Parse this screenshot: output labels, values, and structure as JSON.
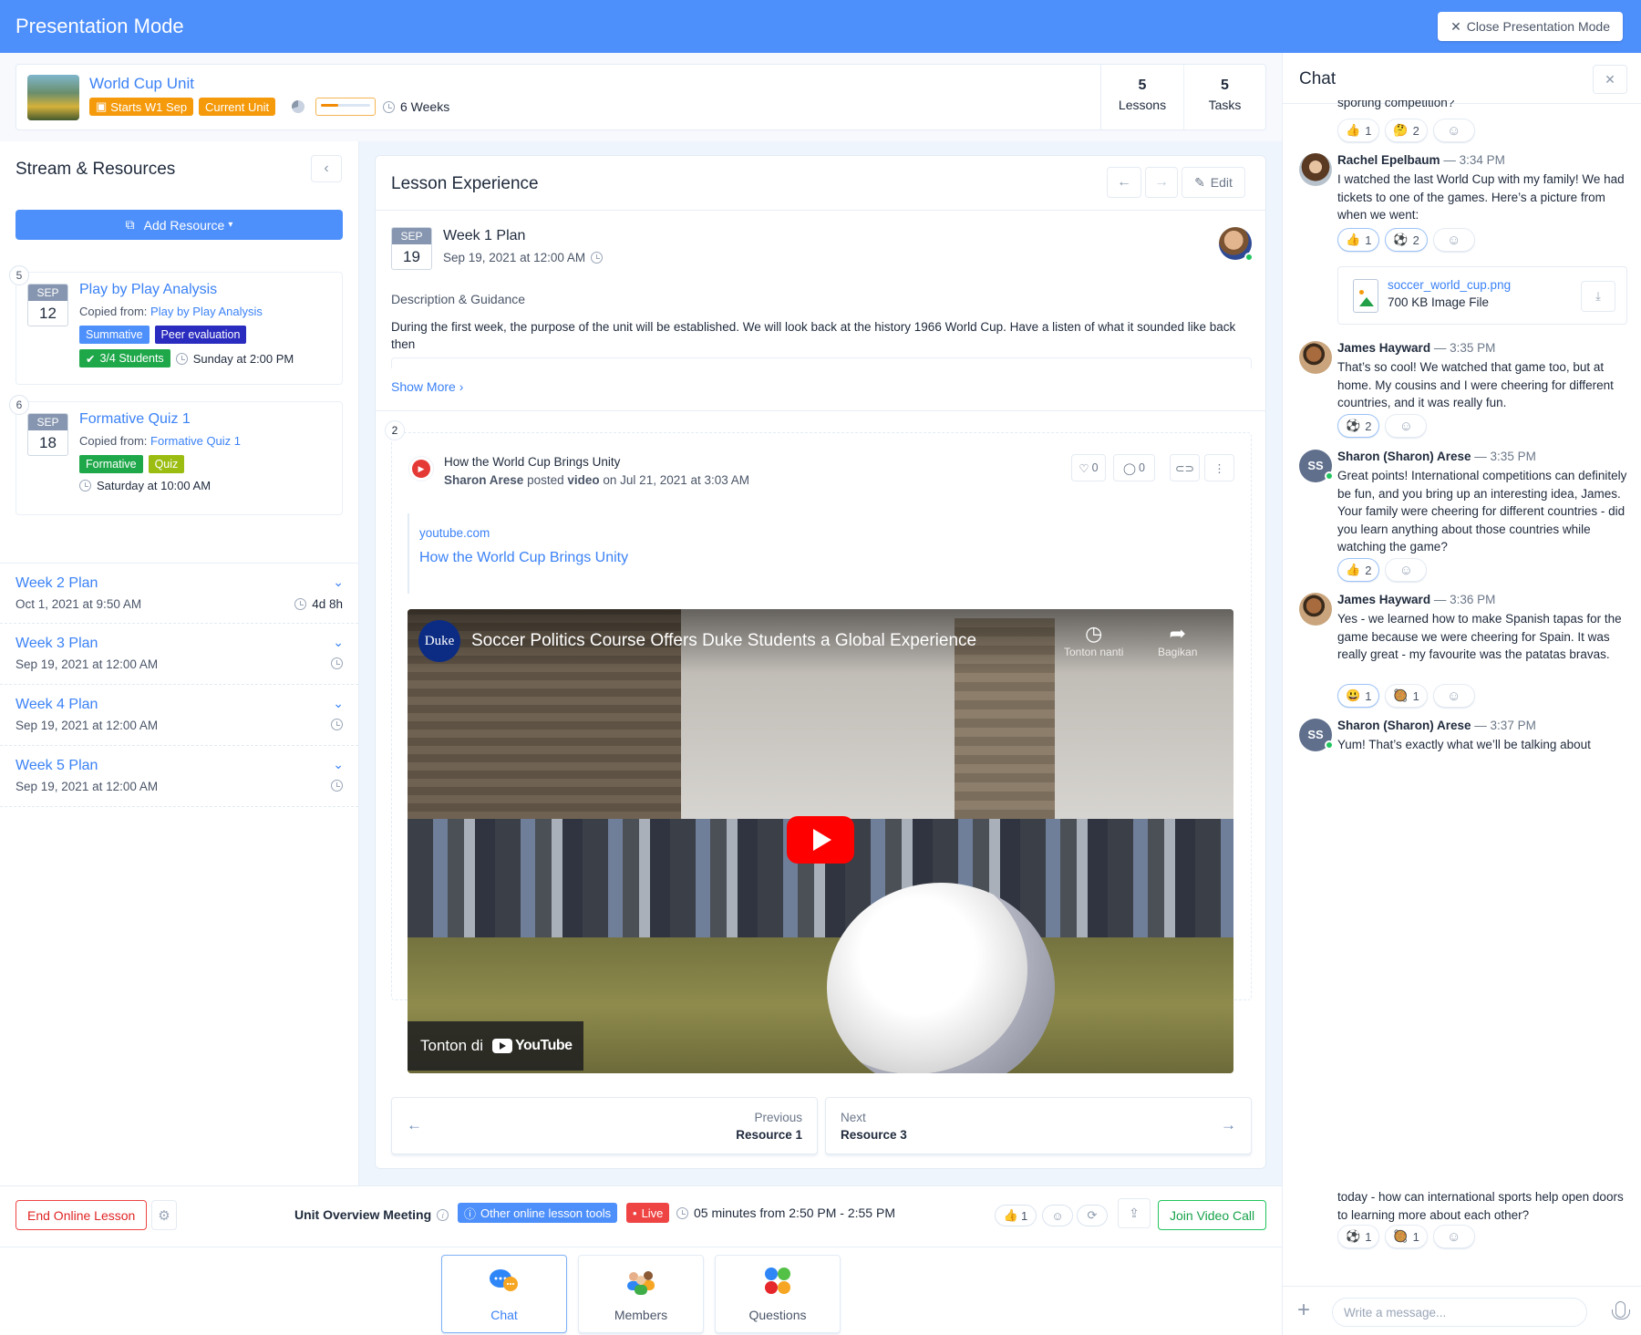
{
  "header": {
    "title": "Presentation Mode",
    "close_label": "Close Presentation Mode"
  },
  "unit": {
    "name": "World Cup Unit",
    "badges": [
      "Starts W1 Sep",
      "Current Unit"
    ],
    "progress_fraction": 0.35,
    "duration": "6 Weeks",
    "stats": [
      {
        "value": "5",
        "label": "Lessons"
      },
      {
        "value": "5",
        "label": "Tasks"
      }
    ]
  },
  "sidebar": {
    "title": "Stream & Resources",
    "add_resource_label": "Add Resource",
    "resources": [
      {
        "num": "5",
        "month": "SEP",
        "day": "12",
        "title": "Play by Play Analysis",
        "copied_prefix": "Copied from:",
        "copied_link": "Play by Play Analysis",
        "tags": [
          {
            "label": "Summative",
            "color": "#4d8ffb"
          },
          {
            "label": "Peer evaluation",
            "color": "#2a2bbf"
          }
        ],
        "status": "3/4 Students",
        "due": "Sunday at 2:00 PM"
      },
      {
        "num": "6",
        "month": "SEP",
        "day": "18",
        "title": "Formative Quiz 1",
        "copied_prefix": "Copied from:",
        "copied_link": "Formative Quiz 1",
        "tags": [
          {
            "label": "Formative",
            "color": "#1fa84a"
          },
          {
            "label": "Quiz",
            "color": "#9bbd12"
          }
        ],
        "due": "Saturday at 10:00 AM"
      }
    ],
    "weeks": [
      {
        "title": "Week 2 Plan",
        "date": "Oct 1, 2021 at 9:50 AM",
        "remaining": "4d 8h"
      },
      {
        "title": "Week 3 Plan",
        "date": "Sep 19, 2021 at 12:00 AM"
      },
      {
        "title": "Week 4 Plan",
        "date": "Sep 19, 2021 at 12:00 AM"
      },
      {
        "title": "Week 5 Plan",
        "date": "Sep 19, 2021 at 12:00 AM"
      }
    ]
  },
  "lesson": {
    "title": "Lesson Experience",
    "edit_label": "Edit",
    "plan": {
      "month": "SEP",
      "day": "19",
      "title": "Week 1 Plan",
      "date": "Sep 19, 2021 at 12:00 AM"
    },
    "desc_label": "Description & Guidance",
    "description": "During the first week, the purpose of the unit will be established. We will look back at the history 1966 World Cup. Have a listen of what it sounded like back then",
    "show_more": "Show More",
    "post": {
      "num": "2",
      "title": "How the World Cup Brings Unity",
      "author": "Sharon Arese",
      "verb": "posted",
      "type": "video",
      "date_text": "on Jul 21, 2021 at 3:03 AM",
      "likes": "0",
      "comments": "0",
      "link_domain": "youtube.com",
      "link_title": "How the World Cup Brings Unity",
      "video": {
        "channel_logo": "Duke",
        "title": "Soccer Politics Course Offers Duke Students a Global Experience",
        "watch_later": "Tonton nanti",
        "share": "Bagikan",
        "watch_on": "Tonton di",
        "brand": "YouTube"
      }
    },
    "nav": {
      "prev_label": "Previous",
      "prev_target": "Resource 1",
      "next_label": "Next",
      "next_target": "Resource 3"
    }
  },
  "meeting": {
    "end_label": "End Online Lesson",
    "name": "Unit Overview Meeting",
    "tools_label": "Other online lesson tools",
    "live_label": "Live",
    "time_range": "05 minutes from 2:50 PM - 2:55 PM",
    "thumbs_count": "1",
    "join_label": "Join Video Call",
    "tiles": [
      {
        "label": "Chat"
      },
      {
        "label": "Members"
      },
      {
        "label": "Questions"
      }
    ]
  },
  "chat": {
    "title": "Chat",
    "top_cut_text": "sporting competition?",
    "top_reactions": [
      {
        "emoji": "👍",
        "count": "1"
      },
      {
        "emoji": "🤔",
        "count": "2"
      }
    ],
    "messages": [
      {
        "author": "Rachel Epelbaum",
        "time": "— 3:34 PM",
        "text": "I watched the last World Cup with my family! We had tickets to one of the games. Here’s a picture from when we went:",
        "reactions": [
          {
            "emoji": "👍",
            "count": "1"
          },
          {
            "emoji": "⚽",
            "count": "2"
          }
        ],
        "file": {
          "name": "soccer_world_cup.png",
          "size": "700 KB Image File"
        }
      },
      {
        "author": "James Hayward",
        "time": "— 3:35 PM",
        "text": "That’s so cool! We watched that game too, but at home. My cousins and I were cheering for different countries, and it was really fun.",
        "reactions": [
          {
            "emoji": "⚽",
            "count": "2"
          }
        ]
      },
      {
        "author": "Sharon (Sharon) Arese",
        "initials": "SS",
        "time": "— 3:35 PM",
        "text": "Great points! International competitions can definitely be fun, and you bring up an interesting idea, James. Your family were cheering for different countries - did you learn anything about those countries while watching the game?",
        "reactions": [
          {
            "emoji": "👍",
            "count": "2"
          }
        ]
      },
      {
        "author": "James Hayward",
        "time": "— 3:36 PM",
        "text": "Yes - we learned how to make Spanish tapas for the game because we were cheering for Spain. It was really great - my favourite was the patatas bravas.",
        "reactions": [
          {
            "emoji": "😃",
            "count": "1"
          },
          {
            "emoji": "🥘",
            "count": "1"
          }
        ]
      },
      {
        "author": "Sharon (Sharon) Arese",
        "initials": "SS",
        "time": "— 3:37 PM",
        "text": "Yum! That’s exactly what we’ll be talking about"
      }
    ],
    "bottom_text": "today - how can international sports help open doors to learning more about each other?",
    "bottom_reactions": [
      {
        "emoji": "⚽",
        "count": "1"
      },
      {
        "emoji": "🥘",
        "count": "1"
      }
    ],
    "input_placeholder": "Write a message..."
  }
}
